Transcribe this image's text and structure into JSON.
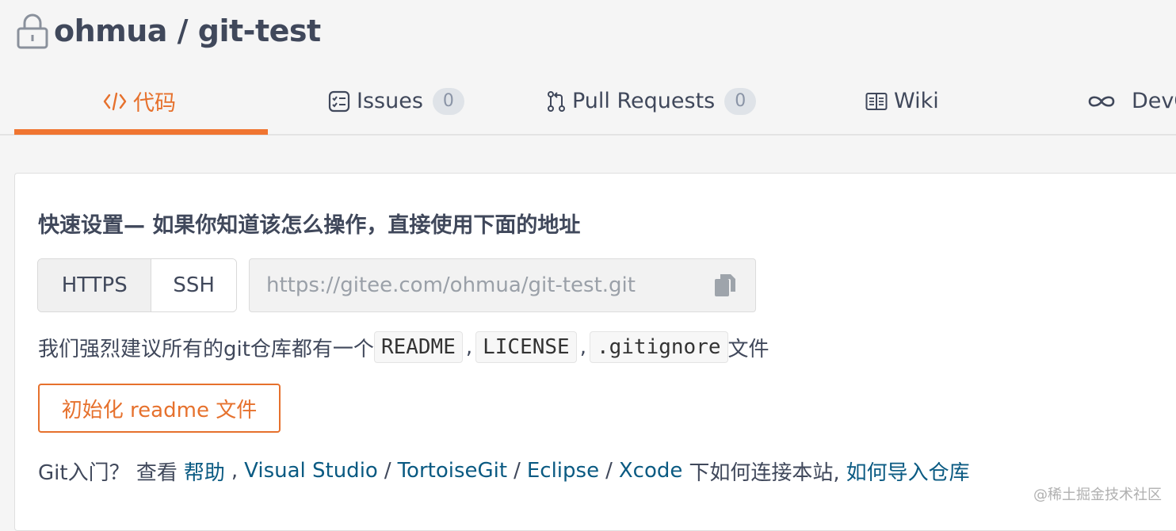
{
  "repo": {
    "title": "ohmua / git-test"
  },
  "tabs": [
    {
      "label": "代码",
      "icon": "code-icon",
      "active": true
    },
    {
      "label": "Issues",
      "icon": "issues-icon",
      "count": "0"
    },
    {
      "label": "Pull Requests",
      "icon": "pull-request-icon",
      "count": "0"
    },
    {
      "label": "Wiki",
      "icon": "wiki-book-icon"
    },
    {
      "label": "DevO",
      "icon": "infinity-icon"
    }
  ],
  "quick_setup": {
    "title": "快速设置— 如果你知道该怎么操作，直接使用下面的地址",
    "protocols": [
      "HTTPS",
      "SSH"
    ],
    "url": "https://gitee.com/ohmua/git-test.git"
  },
  "recommend": {
    "prefix": "我们强烈建议所有的git仓库都有一个",
    "files": [
      "README",
      "LICENSE",
      ".gitignore"
    ],
    "separator": ",",
    "suffix": "文件"
  },
  "init_button": "初始化 readme 文件",
  "help": {
    "prefix": "Git入门？ 查看",
    "link_help": "帮助",
    "comma": ",",
    "tools": [
      "Visual Studio",
      "TortoiseGit",
      "Eclipse",
      "Xcode"
    ],
    "slash": "/",
    "middle": "下如何连接本站,",
    "link_import": "如何导入仓库"
  },
  "watermark": "@稀土掘金技术社区",
  "colors": {
    "accent": "#e6712d",
    "link": "#0a5a82",
    "text": "#40485b"
  }
}
